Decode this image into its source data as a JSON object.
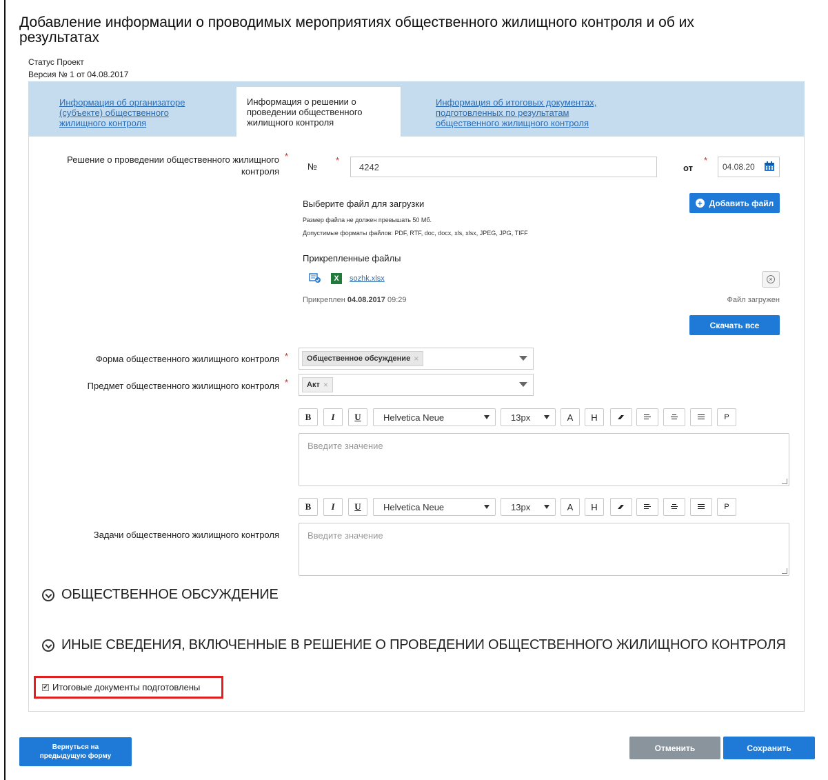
{
  "page": {
    "title": "Добавление информации о проводимых мероприятиях общественного жилищного контроля и об их результатах",
    "status_text": "Статус Проект",
    "version_text": "Версия № 1 от 04.08.2017"
  },
  "tabs": [
    {
      "label": "Информация об организаторе (субъекте) общественного жилищного контроля"
    },
    {
      "label": "Информация о решении о проведении общественного жилищного контроля"
    },
    {
      "label": "Информация об итоговых документах, подготовленных по результатам общественного жилищного контроля"
    }
  ],
  "decision": {
    "label": "Решение о проведении общественного жилищного контроля",
    "number_label": "№",
    "number_value": "4242",
    "date_label": "от",
    "date_value": "04.08.20"
  },
  "upload": {
    "title": "Выберите файл для загрузки",
    "add_button": "Добавить файл",
    "size_note": "Размер файла не должен превышать 50 Мб.",
    "formats_note": "Допустимые форматы файлов: PDF, RTF, doc, docx, xls, xlsx, JPEG, JPG, TIFF",
    "attached_title": "Прикрепленные файлы",
    "file_name": "sozhk.xlsx",
    "attached_prefix": "Прикреплен",
    "attached_date": "04.08.2017",
    "attached_time": "09:29",
    "file_status": "Файл загружен",
    "download_all": "Скачать все"
  },
  "form": {
    "label": "Форма общественного жилищного контроля",
    "chip": "Общественное обсуждение"
  },
  "subject": {
    "label": "Предмет общественного жилищного контроля",
    "chip": "Акт"
  },
  "toolbar": {
    "bold": "B",
    "italic": "I",
    "underline": "U",
    "font": "Helvetica Neue",
    "size": "13px",
    "color": "A",
    "highlight": "H",
    "paragraph": "P"
  },
  "editor1": {
    "placeholder": "Введите значение"
  },
  "tasks": {
    "label": "Задачи общественного жилищного контроля",
    "placeholder": "Введите значение"
  },
  "sections": [
    {
      "title": "ОБЩЕСТВЕННОЕ ОБСУЖДЕНИЕ"
    },
    {
      "title": "ИНЫЕ СВЕДЕНИЯ, ВКЛЮЧЕННЫЕ В РЕШЕНИЕ О ПРОВЕДЕНИИ ОБЩЕСТВЕННОГО ЖИЛИЩНОГО КОНТРОЛЯ"
    }
  ],
  "final_docs": {
    "label": "Итоговые документы подготовлены",
    "checked": true
  },
  "footer": {
    "back": "Вернуться на предыдущую форму",
    "cancel": "Отменить",
    "save": "Сохранить"
  },
  "colors": {
    "primary": "#1e7ad6",
    "tab_bg": "#c5dcef",
    "link": "#2a6cb4",
    "cancel_bg": "#8a949c",
    "highlight_border": "#e02020",
    "required": "#dd2222"
  }
}
